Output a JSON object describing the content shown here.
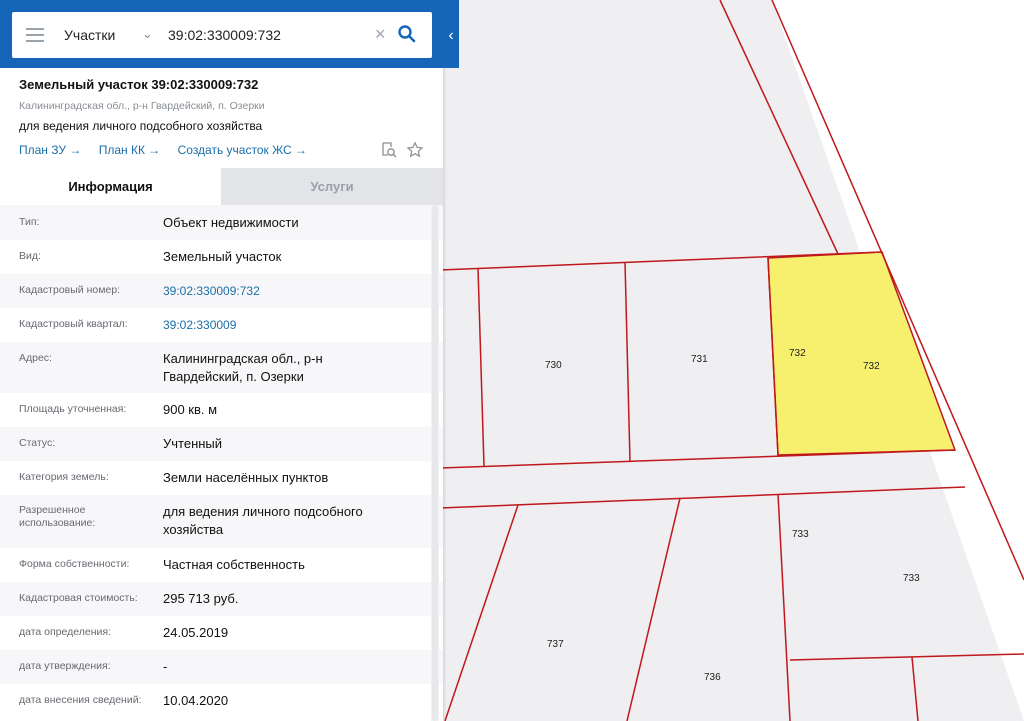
{
  "search": {
    "type_label": "Участки",
    "value": "39:02:330009:732"
  },
  "object": {
    "title": "Земельный участок 39:02:330009:732",
    "address": "Калининградская обл., р-н Гвардейский, п. Озерки",
    "purpose": "для ведения личного подсобного хозяйства",
    "links": [
      "План ЗУ →",
      "План КК →",
      "Создать участок ЖС →"
    ]
  },
  "tabs": [
    "Информация",
    "Услуги"
  ],
  "info_rows": [
    {
      "label": "Тип:",
      "value": "Объект недвижимости"
    },
    {
      "label": "Вид:",
      "value": "Земельный участок"
    },
    {
      "label": "Кадастровый номер:",
      "value": "39:02:330009:732"
    },
    {
      "label": "Кадастровый квартал:",
      "value": "39:02:330009"
    },
    {
      "label": "Адрес:",
      "value": "Калининградская обл., р-н Гвардейский, п. Озерки"
    },
    {
      "label": "Площадь уточненная:",
      "value": "900 кв. м"
    },
    {
      "label": "Статус:",
      "value": "Учтенный"
    },
    {
      "label": "Категория земель:",
      "value": "Земли населённых пунктов"
    },
    {
      "label": "Разрешенное использование:",
      "value": "для ведения личного подсобного хозяйства"
    },
    {
      "label": "Форма собственности:",
      "value": "Частная собственность"
    },
    {
      "label": "Кадастровая стоимость:",
      "value": "295 713 руб."
    },
    {
      "label": "дата определения:",
      "value": "24.05.2019"
    },
    {
      "label": "дата утверждения:",
      "value": "-"
    },
    {
      "label": "дата внесения сведений:",
      "value": "10.04.2020"
    }
  ],
  "map": {
    "parcel_labels": [
      "730",
      "731",
      "732",
      "732",
      "733",
      "733",
      "737",
      "736"
    ],
    "colors": {
      "boundary": "#c0181c",
      "selected_fill": "#f7f06f",
      "background": "#efeef0",
      "header_bg": "#1565b8",
      "link": "#1a6fa8"
    }
  }
}
